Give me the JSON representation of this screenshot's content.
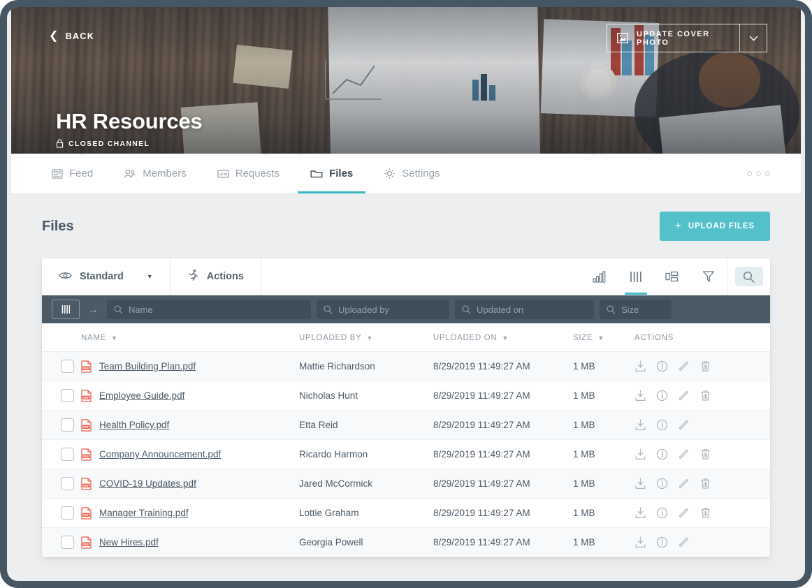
{
  "cover": {
    "back_label": "BACK",
    "update_cover_label": "UPDATE COVER PHOTO",
    "title": "HR Resources",
    "subtitle": "CLOSED CHANNEL"
  },
  "tabs": [
    {
      "label": "Feed",
      "icon": "feed-icon",
      "active": false
    },
    {
      "label": "Members",
      "icon": "members-icon",
      "active": false
    },
    {
      "label": "Requests",
      "icon": "requests-icon",
      "active": false
    },
    {
      "label": "Files",
      "icon": "folder-icon",
      "active": true
    },
    {
      "label": "Settings",
      "icon": "gear-icon",
      "active": false
    }
  ],
  "page": {
    "title": "Files",
    "upload_label": "UPLOAD FILES",
    "upload_plus": "+"
  },
  "toolbar": {
    "view_label": "Standard",
    "view_caret": "▼",
    "actions_label": "Actions",
    "icons": [
      "chart-icon",
      "columns-icon",
      "layout-icon",
      "filter-icon",
      "search-icon"
    ]
  },
  "filterbar": {
    "columns_icon": "columns-icon",
    "arrow": "→",
    "fields": [
      {
        "name": "name-filter",
        "placeholder": "Name",
        "value": ""
      },
      {
        "name": "uploaded-by-filter",
        "placeholder": "Uploaded by",
        "value": ""
      },
      {
        "name": "updated-on-filter",
        "placeholder": "Updated on",
        "value": ""
      },
      {
        "name": "size-filter",
        "placeholder": "Size",
        "value": ""
      }
    ]
  },
  "table": {
    "columns": [
      {
        "label": "NAME",
        "sortable": true
      },
      {
        "label": "UPLOADED BY",
        "sortable": true
      },
      {
        "label": "UPLOADED ON",
        "sortable": true
      },
      {
        "label": "SIZE",
        "sortable": true
      },
      {
        "label": "ACTIONS",
        "sortable": false
      }
    ],
    "rows": [
      {
        "name": "Team Building Plan.pdf",
        "uploaded_by": "Mattie Richardson",
        "uploaded_on": "8/29/2019 11:49:27 AM",
        "size": "1 MB",
        "actions": [
          "download-icon",
          "info-icon",
          "edit-icon",
          "delete-icon"
        ]
      },
      {
        "name": "Employee Guide.pdf",
        "uploaded_by": "Nicholas Hunt",
        "uploaded_on": "8/29/2019 11:49:27 AM",
        "size": "1 MB",
        "actions": [
          "download-icon",
          "info-icon",
          "edit-icon",
          "delete-icon"
        ]
      },
      {
        "name": "Health Policy.pdf",
        "uploaded_by": "Etta Reid",
        "uploaded_on": "8/29/2019 11:49:27 AM",
        "size": "1 MB",
        "actions": [
          "download-icon",
          "info-icon",
          "edit-icon"
        ]
      },
      {
        "name": "Company Announcement.pdf",
        "uploaded_by": "Ricardo Harmon",
        "uploaded_on": "8/29/2019 11:49:27 AM",
        "size": "1 MB",
        "actions": [
          "download-icon",
          "info-icon",
          "edit-icon",
          "delete-icon"
        ]
      },
      {
        "name": "COVID-19 Updates.pdf",
        "uploaded_by": "Jared McCormick",
        "uploaded_on": "8/29/2019 11:49:27 AM",
        "size": "1 MB",
        "actions": [
          "download-icon",
          "info-icon",
          "edit-icon",
          "delete-icon"
        ]
      },
      {
        "name": "Manager Training.pdf",
        "uploaded_by": "Lottie Graham",
        "uploaded_on": "8/29/2019 11:49:27 AM",
        "size": "1 MB",
        "actions": [
          "download-icon",
          "info-icon",
          "edit-icon",
          "delete-icon"
        ]
      },
      {
        "name": "New Hires.pdf",
        "uploaded_by": "Georgia Powell",
        "uploaded_on": "8/29/2019 11:49:27 AM",
        "size": "1 MB",
        "actions": [
          "download-icon",
          "info-icon",
          "edit-icon"
        ]
      }
    ]
  },
  "colors": {
    "accent": "#3ab8c6",
    "upload_button": "#53c0ca",
    "filter_bar": "#4a5a66",
    "frame": "#475663",
    "pdf_icon": "#e8503a",
    "text": "#4c5a66"
  }
}
